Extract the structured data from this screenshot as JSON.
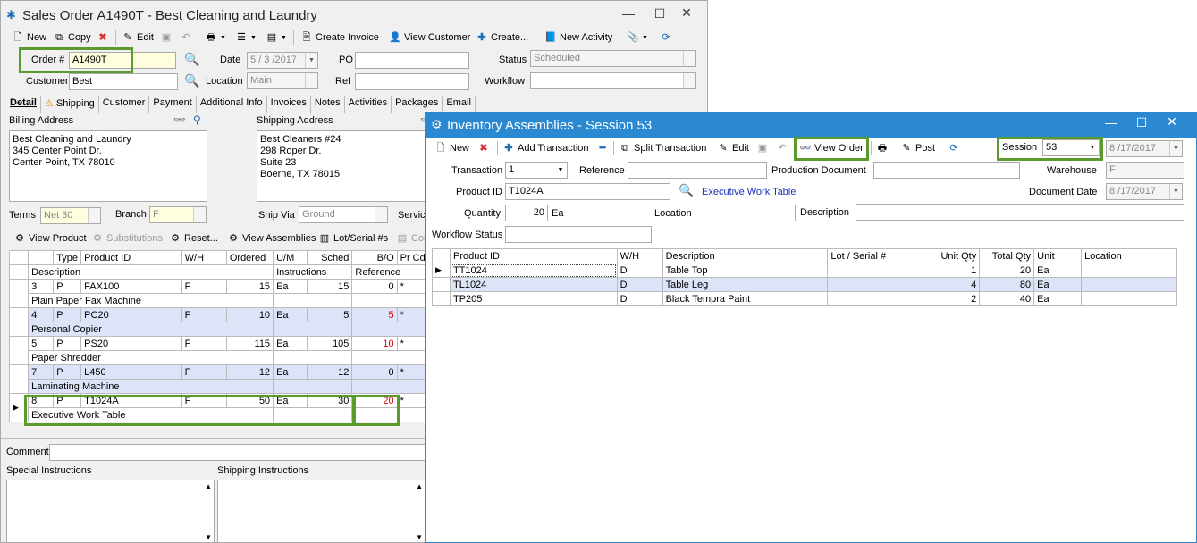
{
  "so": {
    "title": "Sales Order A1490T - Best Cleaning and Laundry",
    "toolbar": {
      "new": "New",
      "copy": "Copy",
      "edit": "Edit",
      "create_invoice": "Create Invoice",
      "view_customer": "View Customer",
      "create": "Create...",
      "new_activity": "New Activity"
    },
    "fields": {
      "order_label": "Order #",
      "order_value": "A1490T",
      "date_label": "Date",
      "date_value": "5 / 3 /2017",
      "po_label": "PO",
      "po_value": "",
      "status_label": "Status",
      "status_value": "Scheduled",
      "customer_label": "Customer",
      "customer_value": "Best",
      "location_label": "Location",
      "location_value": "Main",
      "ref_label": "Ref",
      "ref_value": "",
      "workflow_label": "Workflow",
      "workflow_value": ""
    },
    "tabs": [
      "Detail",
      "Shipping",
      "Customer",
      "Payment",
      "Additional Info",
      "Invoices",
      "Notes",
      "Activities",
      "Packages",
      "Email"
    ],
    "billing_label": "Billing Address",
    "billing_address": "Best Cleaning and Laundry\n345 Center Point Dr.\nCenter Point, TX 78010",
    "shipping_label": "Shipping Address",
    "shipping_address": "Best Cleaners #24\n298 Roper Dr.\nSuite 23\nBoerne, TX 78015",
    "terms_label": "Terms",
    "terms_value": "Net 30",
    "branch_label": "Branch",
    "branch_value": "F",
    "shipvia_label": "Ship Via",
    "shipvia_value": "Ground",
    "service_label": "Servic",
    "detail_toolbar": {
      "view_product": "View Product",
      "substitutions": "Substitutions",
      "reset": "Reset...",
      "view_assemblies": "View Assemblies",
      "lot_serial": "Lot/Serial #s",
      "con": "Con"
    },
    "grid_headers": {
      "type": "Type",
      "product_id": "Product ID",
      "wh": "W/H",
      "ordered": "Ordered",
      "um": "U/M",
      "sched": "Sched",
      "bo": "B/O",
      "prcd": "Pr Cd",
      "description": "Description",
      "instructions": "Instructions",
      "reference": "Reference"
    },
    "rows": [
      {
        "line": "3",
        "type": "P",
        "product": "FAX100",
        "wh": "F",
        "ordered": "15",
        "um": "Ea",
        "sched": "15",
        "bo": "0",
        "prcd": "*",
        "desc": "Plain Paper Fax Machine"
      },
      {
        "line": "4",
        "type": "P",
        "product": "PC20",
        "wh": "F",
        "ordered": "10",
        "um": "Ea",
        "sched": "5",
        "bo": "5",
        "prcd": "*",
        "desc": "Personal Copier"
      },
      {
        "line": "5",
        "type": "P",
        "product": "PS20",
        "wh": "F",
        "ordered": "115",
        "um": "Ea",
        "sched": "105",
        "bo": "10",
        "prcd": "*",
        "desc": "Paper Shredder"
      },
      {
        "line": "7",
        "type": "P",
        "product": "L450",
        "wh": "F",
        "ordered": "12",
        "um": "Ea",
        "sched": "12",
        "bo": "0",
        "prcd": "*",
        "desc": "Laminating Machine"
      },
      {
        "line": "8",
        "type": "P",
        "product": "T1024A",
        "wh": "F",
        "ordered": "50",
        "um": "Ea",
        "sched": "30",
        "bo": "20",
        "prcd": "*",
        "desc": "Executive Work Table"
      }
    ],
    "comment_label": "Comment",
    "special_label": "Special Instructions",
    "shipping_instr_label": "Shipping Instructions"
  },
  "ia": {
    "title": "Inventory Assemblies - Session 53",
    "toolbar": {
      "new": "New",
      "add_transaction": "Add Transaction",
      "split_transaction": "Split Transaction",
      "edit": "Edit",
      "view_order": "View Order",
      "post": "Post",
      "session_label": "Session",
      "session_value": "53",
      "session_date": "8 /17/2017"
    },
    "fields": {
      "transaction_label": "Transaction",
      "transaction_value": "1",
      "reference_label": "Reference",
      "reference_value": "",
      "prod_doc_label": "Production Document",
      "prod_doc_value": "",
      "warehouse_label": "Warehouse",
      "warehouse_value": "F",
      "product_id_label": "Product ID",
      "product_id_value": "T1024A",
      "product_desc": "Executive Work Table",
      "doc_date_label": "Document Date",
      "doc_date_value": "8 /17/2017",
      "quantity_label": "Quantity",
      "quantity_value": "20",
      "quantity_unit": "Ea",
      "location_label": "Location",
      "location_value": "",
      "description_label": "Description",
      "description_value": "",
      "workflow_label": "Workflow Status",
      "workflow_value": ""
    },
    "grid_headers": {
      "product_id": "Product ID",
      "wh": "W/H",
      "description": "Description",
      "lot": "Lot / Serial #",
      "unit_qty": "Unit Qty",
      "total_qty": "Total Qty",
      "unit": "Unit",
      "location": "Location"
    },
    "rows": [
      {
        "product": "TT1024",
        "wh": "D",
        "desc": "Table Top",
        "lot": "",
        "unit_qty": "1",
        "total_qty": "20",
        "unit": "Ea",
        "loc": ""
      },
      {
        "product": "TL1024",
        "wh": "D",
        "desc": "Table Leg",
        "lot": "",
        "unit_qty": "4",
        "total_qty": "80",
        "unit": "Ea",
        "loc": ""
      },
      {
        "product": "TP205",
        "wh": "D",
        "desc": "Black Tempra Paint",
        "lot": "",
        "unit_qty": "2",
        "total_qty": "40",
        "unit": "Ea",
        "loc": ""
      }
    ]
  }
}
